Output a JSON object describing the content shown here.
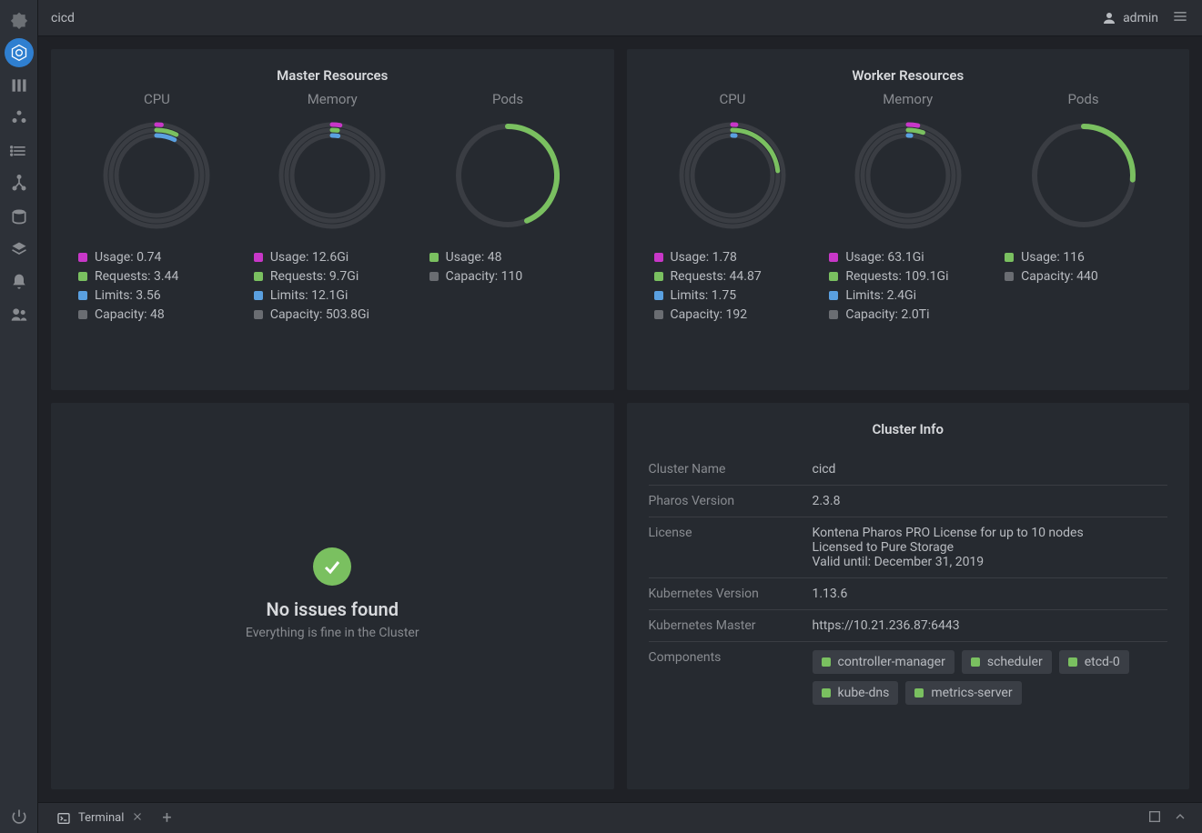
{
  "header": {
    "breadcrumb": "cicd",
    "user": "admin"
  },
  "chart_data": [
    {
      "title": "Master Resources",
      "gauges": [
        {
          "label": "CPU",
          "type": "multi-ring",
          "metrics": [
            {
              "name": "Usage",
              "value": "0.74",
              "numeric": 0.74,
              "color": "magenta"
            },
            {
              "name": "Requests",
              "value": "3.44",
              "numeric": 3.44,
              "color": "green"
            },
            {
              "name": "Limits",
              "value": "3.56",
              "numeric": 3.56,
              "color": "blue"
            },
            {
              "name": "Capacity",
              "value": "48",
              "numeric": 48,
              "color": "grey"
            }
          ]
        },
        {
          "label": "Memory",
          "type": "multi-ring",
          "metrics": [
            {
              "name": "Usage",
              "value": "12.6Gi",
              "numeric": 12.6,
              "color": "magenta"
            },
            {
              "name": "Requests",
              "value": "9.7Gi",
              "numeric": 9.7,
              "color": "green"
            },
            {
              "name": "Limits",
              "value": "12.1Gi",
              "numeric": 12.1,
              "color": "blue"
            },
            {
              "name": "Capacity",
              "value": "503.8Gi",
              "numeric": 503.8,
              "color": "grey"
            }
          ]
        },
        {
          "label": "Pods",
          "type": "single-ring",
          "metrics": [
            {
              "name": "Usage",
              "value": "48",
              "numeric": 48,
              "color": "green"
            },
            {
              "name": "Capacity",
              "value": "110",
              "numeric": 110,
              "color": "grey"
            }
          ]
        }
      ]
    },
    {
      "title": "Worker Resources",
      "gauges": [
        {
          "label": "CPU",
          "type": "multi-ring",
          "metrics": [
            {
              "name": "Usage",
              "value": "1.78",
              "numeric": 1.78,
              "color": "magenta"
            },
            {
              "name": "Requests",
              "value": "44.87",
              "numeric": 44.87,
              "color": "green"
            },
            {
              "name": "Limits",
              "value": "1.75",
              "numeric": 1.75,
              "color": "blue"
            },
            {
              "name": "Capacity",
              "value": "192",
              "numeric": 192,
              "color": "grey"
            }
          ]
        },
        {
          "label": "Memory",
          "type": "multi-ring",
          "metrics": [
            {
              "name": "Usage",
              "value": "63.1Gi",
              "numeric": 63.1,
              "color": "magenta"
            },
            {
              "name": "Requests",
              "value": "109.1Gi",
              "numeric": 109.1,
              "color": "green"
            },
            {
              "name": "Limits",
              "value": "2.4Gi",
              "numeric": 2.4,
              "color": "blue"
            },
            {
              "name": "Capacity",
              "value": "2.0Ti",
              "numeric": 2048,
              "color": "grey"
            }
          ]
        },
        {
          "label": "Pods",
          "type": "single-ring",
          "metrics": [
            {
              "name": "Usage",
              "value": "116",
              "numeric": 116,
              "color": "green"
            },
            {
              "name": "Capacity",
              "value": "440",
              "numeric": 440,
              "color": "grey"
            }
          ]
        }
      ]
    }
  ],
  "issues": {
    "title": "No issues found",
    "subtitle": "Everything is fine in the Cluster"
  },
  "cluster_info": {
    "title": "Cluster Info",
    "rows": [
      {
        "key": "Cluster Name",
        "value": "cicd"
      },
      {
        "key": "Pharos Version",
        "value": "2.3.8"
      },
      {
        "key": "License",
        "value": "Kontena Pharos PRO License for up to 10 nodes\nLicensed to Pure Storage\nValid until: December 31, 2019"
      },
      {
        "key": "Kubernetes Version",
        "value": "1.13.6"
      },
      {
        "key": "Kubernetes Master",
        "value": "https://10.21.236.87:6443"
      }
    ],
    "components_label": "Components",
    "components": [
      "controller-manager",
      "scheduler",
      "etcd-0",
      "kube-dns",
      "metrics-server"
    ]
  },
  "terminal": {
    "tab_label": "Terminal"
  },
  "colors": {
    "magenta": "#c837c8",
    "green": "#7ac060",
    "blue": "#5aa0e0",
    "grey": "#6a6d72"
  }
}
